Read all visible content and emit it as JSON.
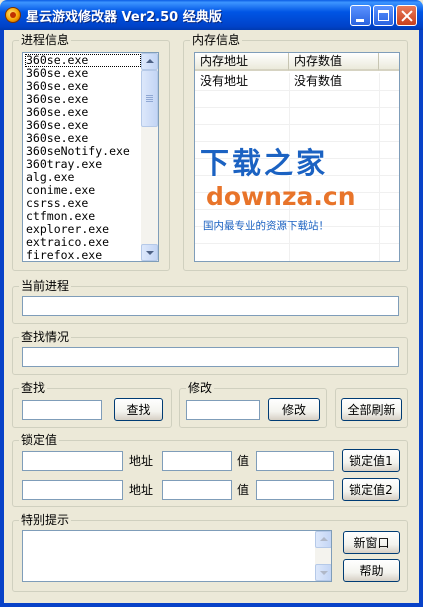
{
  "window": {
    "title": "星云游戏修改器 Ver2.50 经典版",
    "icon": "star-cloud-app-icon",
    "controls": [
      "minimize-icon",
      "maximize-icon",
      "close-icon"
    ]
  },
  "process_panel": {
    "label": "进程信息",
    "selected_index": 0,
    "items": [
      "360se.exe",
      "360se.exe",
      "360se.exe",
      "360se.exe",
      "360se.exe",
      "360se.exe",
      "360se.exe",
      "360seNotify.exe",
      "360tray.exe",
      "alg.exe",
      "conime.exe",
      "csrss.exe",
      "ctfmon.exe",
      "explorer.exe",
      "extraico.exe",
      "firefox.exe"
    ]
  },
  "memory_panel": {
    "label": "内存信息",
    "columns": [
      "内存地址",
      "内存数值"
    ],
    "rows": [
      [
        "没有地址",
        "没有数值"
      ]
    ]
  },
  "watermark": {
    "line1": "下载之家",
    "line2": "downza.cn",
    "line3": "国内最专业的资源下载站！",
    "colors": {
      "blue": "#1B62C2",
      "orange": "#E8742A"
    }
  },
  "current_process": {
    "label": "当前进程",
    "value": ""
  },
  "search_status": {
    "label": "查找情况",
    "value": ""
  },
  "search": {
    "label": "查找",
    "value": "",
    "button": "查找"
  },
  "modify": {
    "label": "修改",
    "value": "",
    "button": "修改"
  },
  "refresh_all": {
    "button": "全部刷新"
  },
  "lock": {
    "label": "锁定值",
    "rows": [
      {
        "name": "",
        "address_label": "地址",
        "address": "",
        "value_label": "值",
        "value": "",
        "button": "锁定值1"
      },
      {
        "name": "",
        "address_label": "地址",
        "address": "",
        "value_label": "值",
        "value": "",
        "button": "锁定值2"
      }
    ]
  },
  "special_tips": {
    "label": "特别提示",
    "text": "",
    "new_window_button": "新窗口",
    "help_button": "帮助"
  },
  "theme": {
    "titlebar": "#0055E5",
    "face": "#ECE9D8",
    "field_border": "#7F9DB9"
  }
}
